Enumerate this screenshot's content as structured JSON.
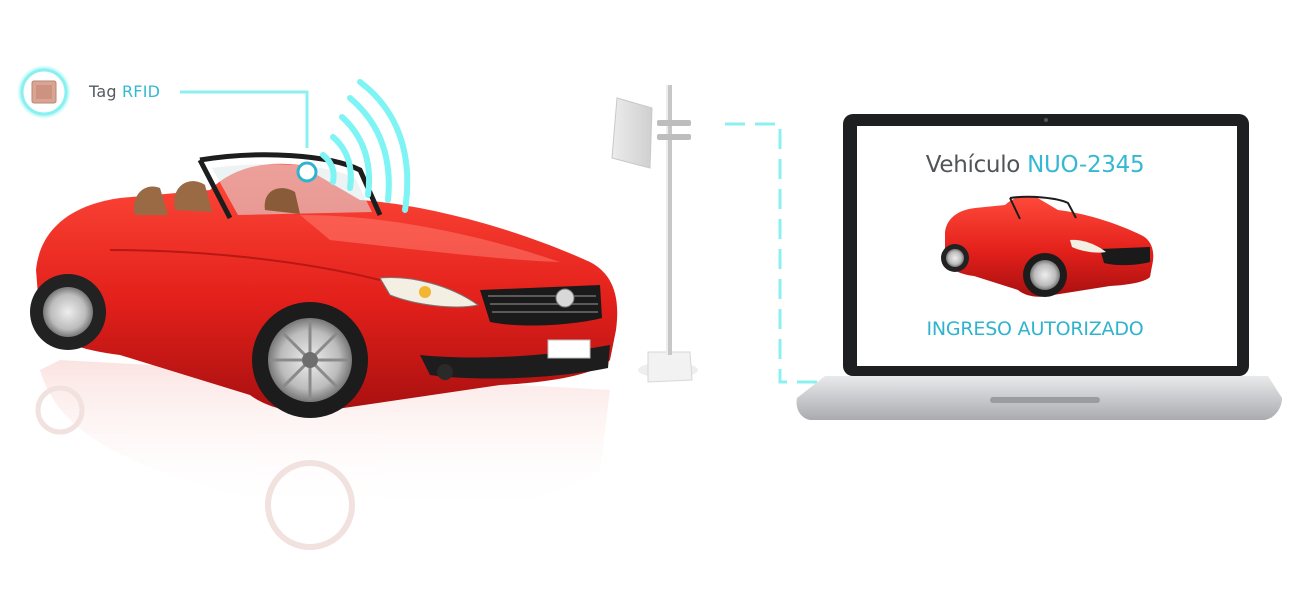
{
  "tag": {
    "prefix": "Tag",
    "accent": "RFID",
    "icon": "rfid-chip-icon"
  },
  "screen": {
    "title_prefix": "Vehículo",
    "plate": "NUO-2345",
    "status": "INGRESO AUTORIZADO"
  },
  "colors": {
    "accent": "#35b8d3",
    "glow": "#7ff4f4",
    "car_body": "#e8221e",
    "text_dark": "#505558"
  }
}
